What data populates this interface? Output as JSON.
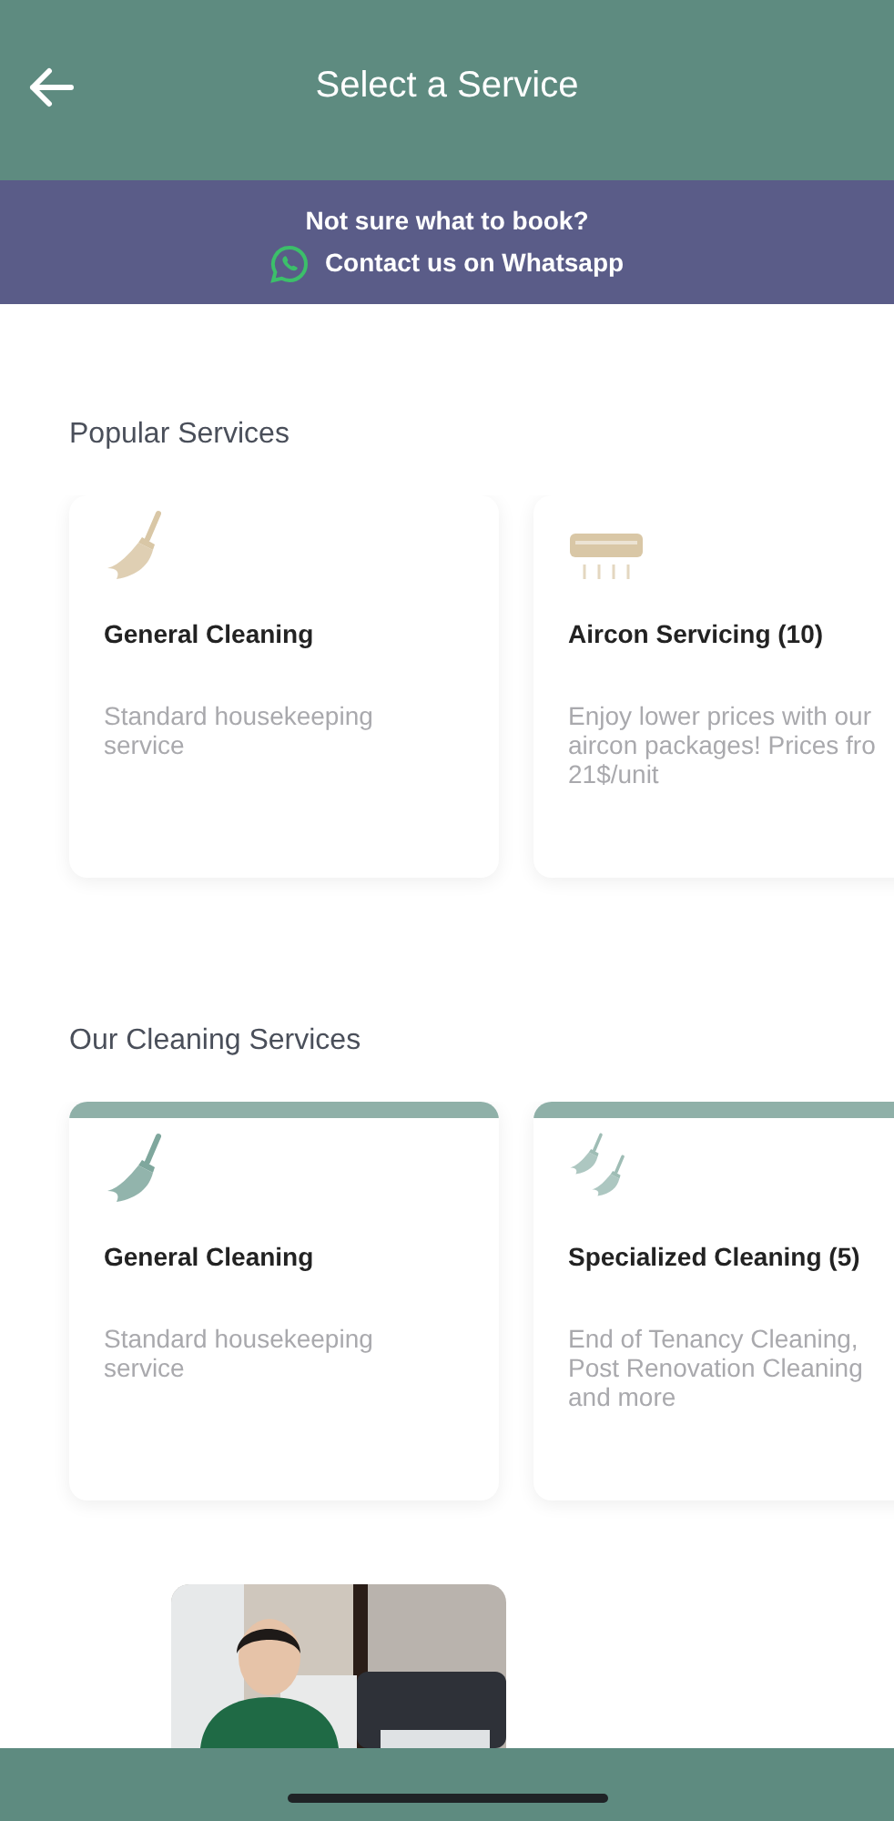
{
  "header": {
    "title": "Select a Service"
  },
  "banner": {
    "question": "Not sure what to book?",
    "link": "Contact us on Whatsapp"
  },
  "sections": [
    {
      "title": "Popular Services",
      "accent": false,
      "cards": [
        {
          "kind": "broom",
          "title": "General Cleaning",
          "description": "Standard housekeeping\nservice"
        },
        {
          "kind": "aircon",
          "title": "Aircon Servicing (10)",
          "description": "Enjoy lower prices with our\naircon packages! Prices fro\n21$/unit"
        }
      ]
    },
    {
      "title": "Our Cleaning Services",
      "accent": true,
      "cards": [
        {
          "kind": "broom",
          "title": "General Cleaning",
          "description": "Standard housekeeping\nservice"
        },
        {
          "kind": "brooms",
          "title": "Specialized Cleaning (5)",
          "description": "End of Tenancy Cleaning,\nPost Renovation Cleaning\nand more"
        }
      ]
    }
  ]
}
